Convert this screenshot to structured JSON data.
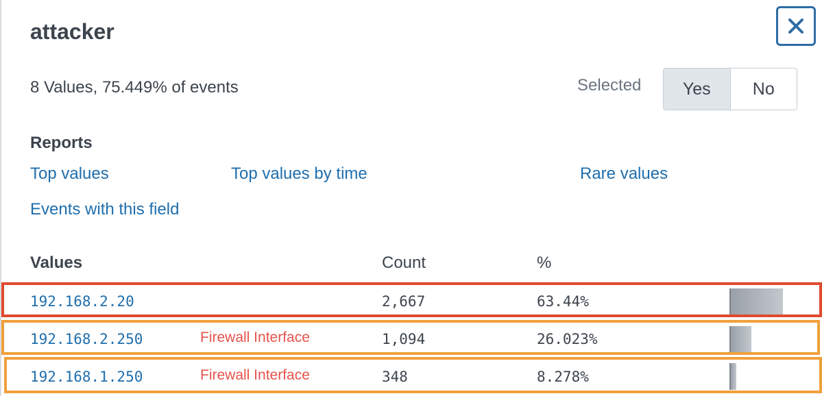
{
  "field_name": "attacker",
  "summary": "8 Values, 75.449% of events",
  "selected": {
    "label": "Selected",
    "options": [
      "Yes",
      "No"
    ],
    "active": "Yes"
  },
  "reports": {
    "heading": "Reports",
    "links": [
      "Top values",
      "Top values by time",
      "Rare values",
      "Events with this field"
    ]
  },
  "table": {
    "headers": [
      "Values",
      "Count",
      "%"
    ],
    "rows": [
      {
        "value": "192.168.2.20",
        "note": "",
        "count": "2,667",
        "percent": "63.44%",
        "fraction": 0.6344
      },
      {
        "value": "192.168.2.250",
        "note": "Firewall Interface",
        "count": "1,094",
        "percent": "26.023%",
        "fraction": 0.26023
      },
      {
        "value": "192.168.1.250",
        "note": "Firewall Interface",
        "count": "348",
        "percent": "8.278%",
        "fraction": 0.08278
      }
    ]
  },
  "colors": {
    "link": "#1f6ead",
    "note": "#e5534b",
    "highlight_first": "#e04a2f",
    "highlight_other": "#f0a03c",
    "close_border": "#2e6ca4"
  },
  "icons": {
    "close": "close-icon"
  }
}
